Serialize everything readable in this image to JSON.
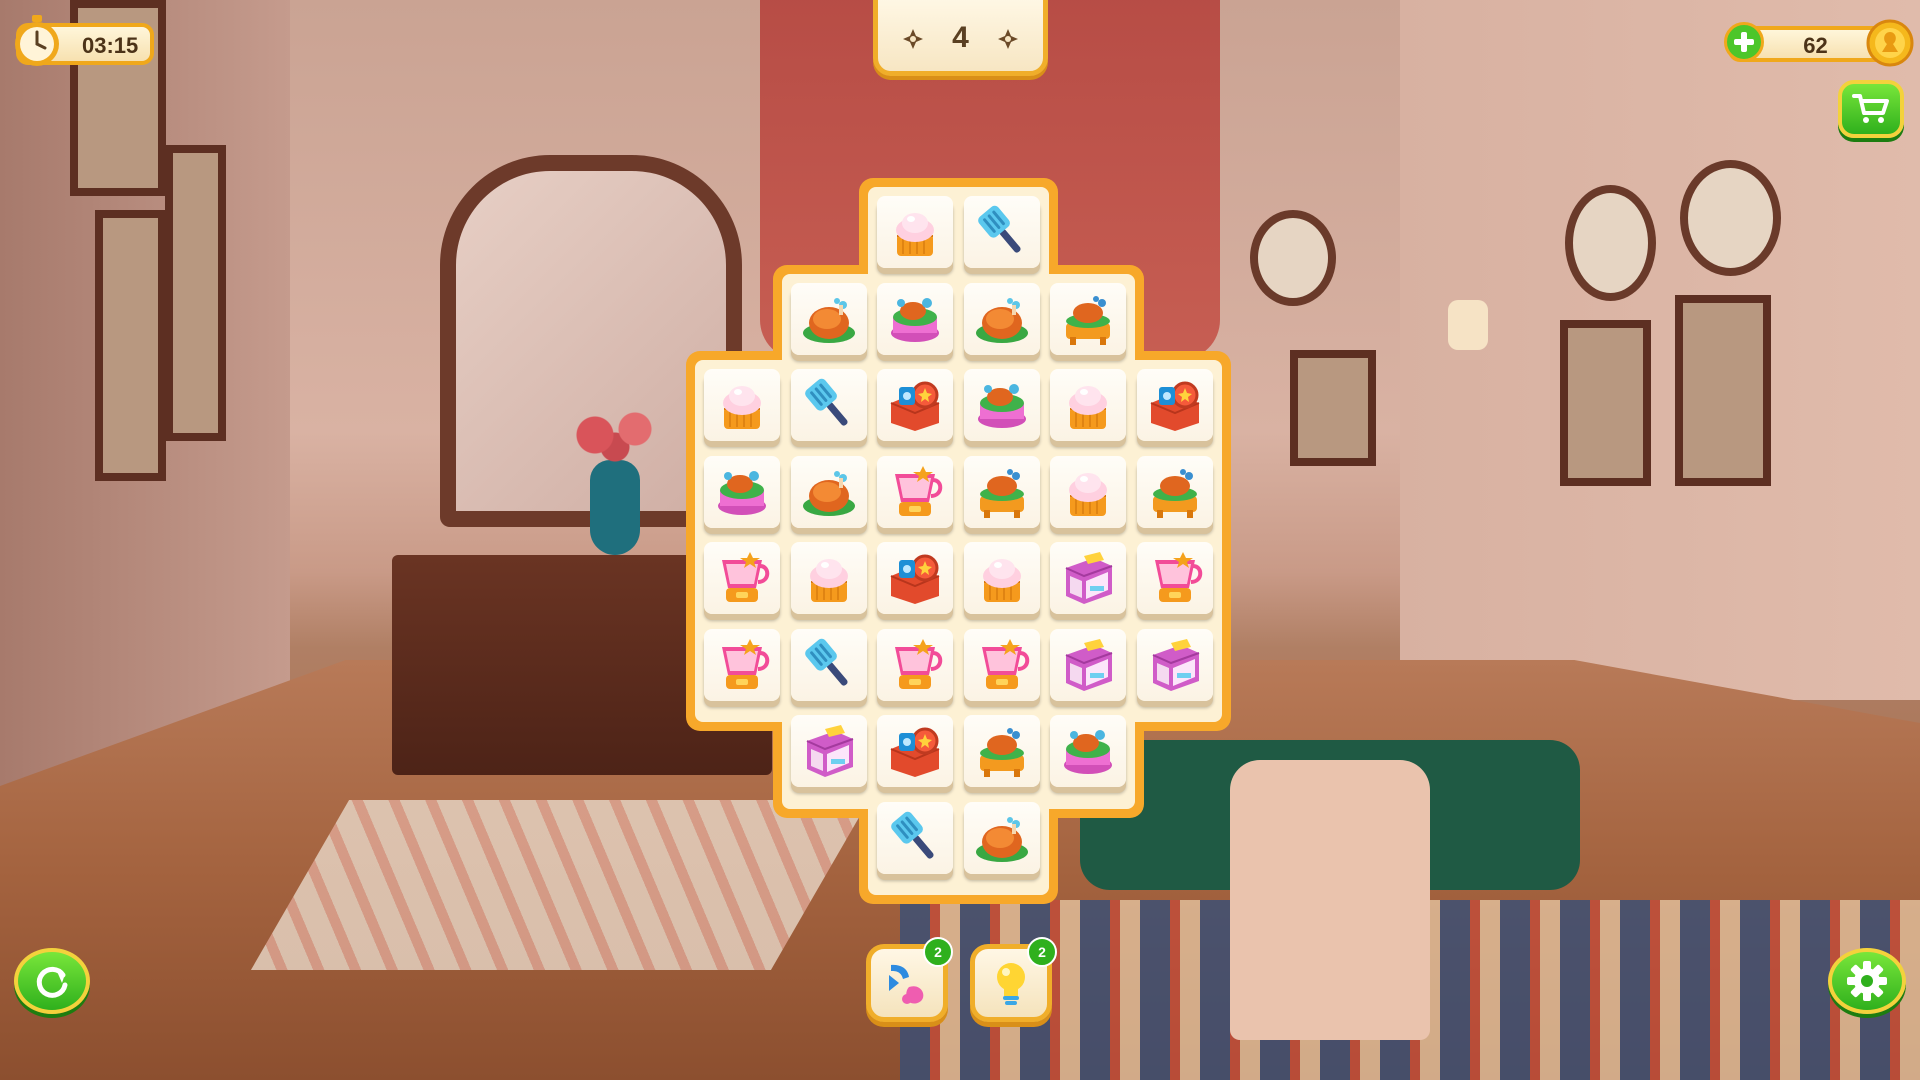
{
  "hud": {
    "timer": "03:15",
    "moves": "4",
    "coins": "62"
  },
  "boosters": {
    "shuffle_count": "2",
    "hint_count": "2"
  },
  "icons": {
    "timer": "stopwatch-icon",
    "coin": "coin-icon",
    "add": "plus-icon",
    "shop": "cart-icon",
    "restart": "refresh-icon",
    "settings": "gear-icon",
    "shuffle": "shuffle-icon",
    "hint": "lightbulb-icon"
  },
  "board": {
    "columns": 6,
    "rows": 8,
    "tiles": [
      {
        "row": 0,
        "col": 2,
        "item": "cupcake"
      },
      {
        "row": 0,
        "col": 3,
        "item": "spatula"
      },
      {
        "row": 1,
        "col": 1,
        "item": "roast-turkey"
      },
      {
        "row": 1,
        "col": 2,
        "item": "pink-cake"
      },
      {
        "row": 1,
        "col": 3,
        "item": "roast-turkey"
      },
      {
        "row": 1,
        "col": 4,
        "item": "turkey-platter"
      },
      {
        "row": 2,
        "col": 0,
        "item": "cupcake"
      },
      {
        "row": 2,
        "col": 1,
        "item": "spatula"
      },
      {
        "row": 2,
        "col": 2,
        "item": "lunchbox"
      },
      {
        "row": 2,
        "col": 3,
        "item": "pink-cake"
      },
      {
        "row": 2,
        "col": 4,
        "item": "cupcake"
      },
      {
        "row": 2,
        "col": 5,
        "item": "lunchbox"
      },
      {
        "row": 3,
        "col": 0,
        "item": "pink-cake"
      },
      {
        "row": 3,
        "col": 1,
        "item": "roast-turkey"
      },
      {
        "row": 3,
        "col": 2,
        "item": "blender"
      },
      {
        "row": 3,
        "col": 3,
        "item": "turkey-platter"
      },
      {
        "row": 3,
        "col": 4,
        "item": "cupcake"
      },
      {
        "row": 3,
        "col": 5,
        "item": "turkey-platter"
      },
      {
        "row": 4,
        "col": 0,
        "item": "blender"
      },
      {
        "row": 4,
        "col": 1,
        "item": "cupcake"
      },
      {
        "row": 4,
        "col": 2,
        "item": "lunchbox"
      },
      {
        "row": 4,
        "col": 3,
        "item": "cupcake"
      },
      {
        "row": 4,
        "col": 4,
        "item": "toaster-oven"
      },
      {
        "row": 4,
        "col": 5,
        "item": "blender"
      },
      {
        "row": 5,
        "col": 0,
        "item": "blender"
      },
      {
        "row": 5,
        "col": 1,
        "item": "spatula"
      },
      {
        "row": 5,
        "col": 2,
        "item": "blender"
      },
      {
        "row": 5,
        "col": 3,
        "item": "blender"
      },
      {
        "row": 5,
        "col": 4,
        "item": "toaster-oven"
      },
      {
        "row": 5,
        "col": 5,
        "item": "toaster-oven"
      },
      {
        "row": 6,
        "col": 1,
        "item": "toaster-oven"
      },
      {
        "row": 6,
        "col": 2,
        "item": "lunchbox"
      },
      {
        "row": 6,
        "col": 3,
        "item": "turkey-platter"
      },
      {
        "row": 6,
        "col": 4,
        "item": "pink-cake"
      },
      {
        "row": 7,
        "col": 2,
        "item": "spatula"
      },
      {
        "row": 7,
        "col": 3,
        "item": "roast-turkey"
      }
    ]
  },
  "colors": {
    "board_border": "#f7a82a",
    "button_green": "#2fb01d",
    "badge_green": "#2fb01d",
    "hud_border": "#f0a81b"
  }
}
